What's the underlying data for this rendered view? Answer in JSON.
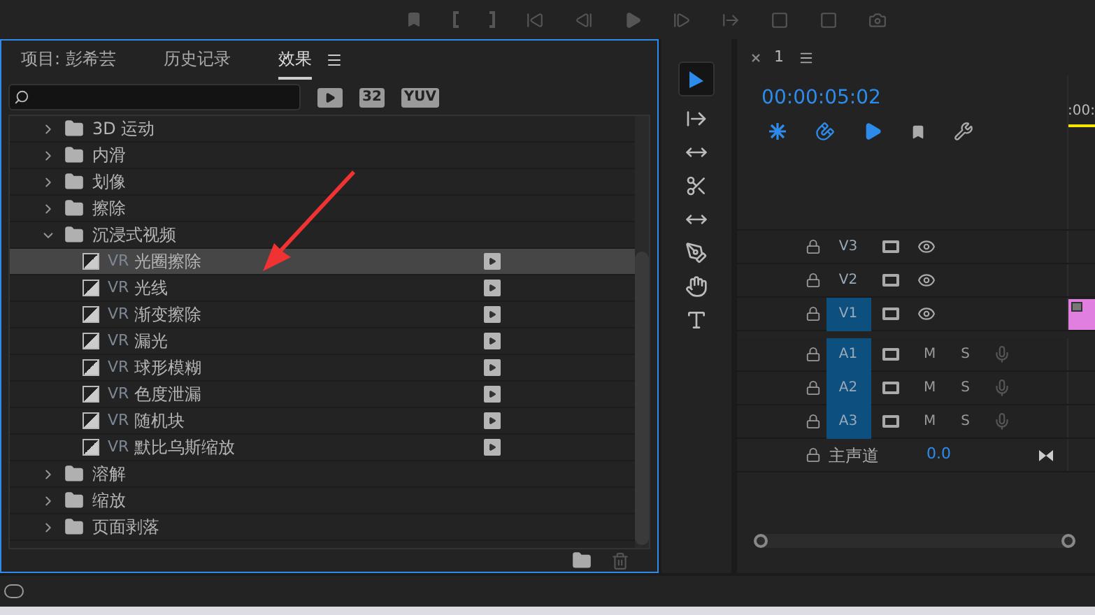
{
  "effects_panel": {
    "tabs": [
      {
        "label": "项目: 彭希芸",
        "selected": false
      },
      {
        "label": "历史记录",
        "selected": false
      },
      {
        "label": "效果",
        "selected": true
      }
    ],
    "filter_badges": [
      {
        "kind": "accelerated"
      },
      {
        "kind": "text",
        "label": "32"
      },
      {
        "kind": "text",
        "label": "YUV"
      }
    ],
    "tree": [
      {
        "label": "3D 运动",
        "expanded": false
      },
      {
        "label": "内滑",
        "expanded": false
      },
      {
        "label": "划像",
        "expanded": false
      },
      {
        "label": "擦除",
        "expanded": false
      },
      {
        "label": "沉浸式视频",
        "expanded": true,
        "children": [
          {
            "prefix": "VR",
            "label": "光圈擦除",
            "selected": true
          },
          {
            "prefix": "VR",
            "label": "光线",
            "selected": false
          },
          {
            "prefix": "VR",
            "label": "渐变擦除",
            "selected": false
          },
          {
            "prefix": "VR",
            "label": "漏光",
            "selected": false
          },
          {
            "prefix": "VR",
            "label": "球形模糊",
            "selected": false
          },
          {
            "prefix": "VR",
            "label": "色度泄漏",
            "selected": false
          },
          {
            "prefix": "VR",
            "label": "随机块",
            "selected": false
          },
          {
            "prefix": "VR",
            "label": "默比乌斯缩放",
            "selected": false
          }
        ]
      },
      {
        "label": "溶解",
        "expanded": false
      },
      {
        "label": "缩放",
        "expanded": false
      },
      {
        "label": "页面剥落",
        "expanded": false
      }
    ]
  },
  "timeline": {
    "sequence_tab": "1",
    "timecode": "00:00:05:02",
    "ruler_label": ":00:",
    "tracks": [
      {
        "kind": "video",
        "name": "V3",
        "targeted": false,
        "has_clip": false
      },
      {
        "kind": "video",
        "name": "V2",
        "targeted": false,
        "has_clip": false
      },
      {
        "kind": "video",
        "name": "V1",
        "targeted": true,
        "has_clip": true
      },
      {
        "kind": "audio",
        "name": "A1",
        "targeted": true,
        "mute": "M",
        "solo": "S",
        "has_clip": false
      },
      {
        "kind": "audio",
        "name": "A2",
        "targeted": true,
        "mute": "M",
        "solo": "S",
        "has_clip": false
      },
      {
        "kind": "audio",
        "name": "A3",
        "targeted": true,
        "mute": "M",
        "solo": "S",
        "has_clip": false
      },
      {
        "kind": "master",
        "name": "主声道",
        "value": "0.0",
        "has_clip": false
      }
    ]
  }
}
